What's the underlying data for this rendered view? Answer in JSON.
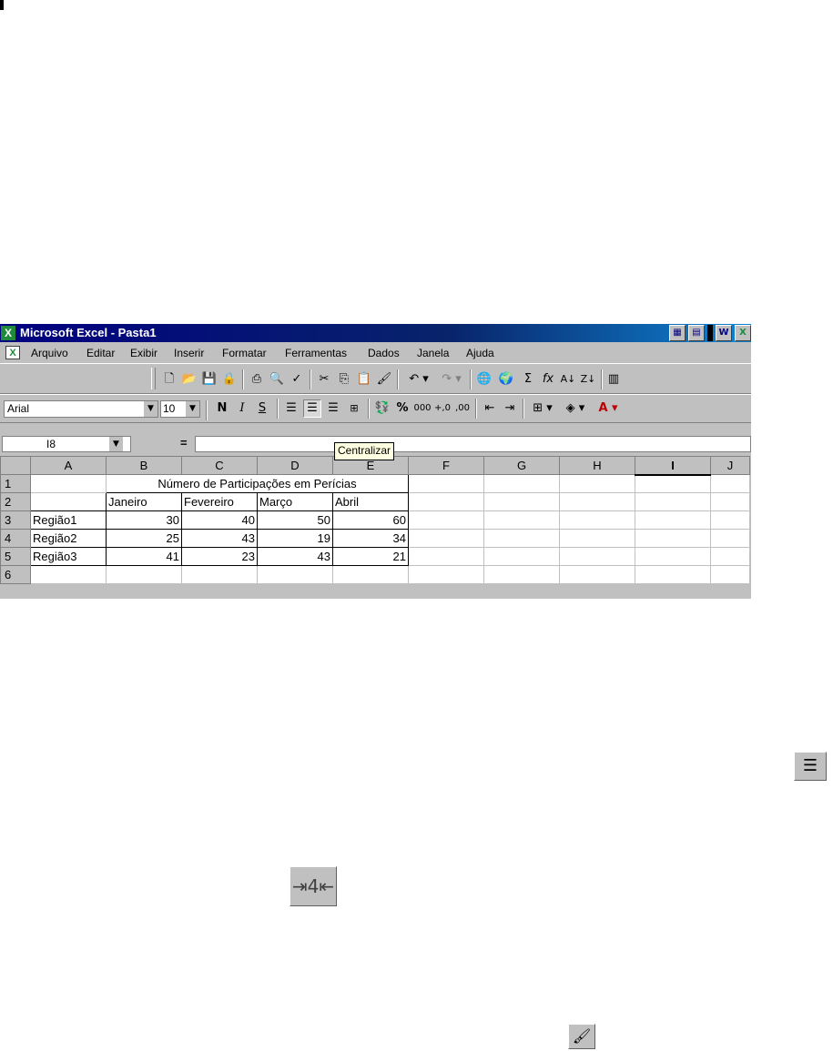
{
  "window": {
    "title": "Microsoft Excel - Pasta1"
  },
  "menu": [
    "Arquivo",
    "Editar",
    "Exibir",
    "Inserir",
    "Formatar",
    "Ferramentas",
    "Dados",
    "Janela",
    "Ajuda"
  ],
  "formatting": {
    "font": "Arial",
    "size": "10",
    "bold": "N",
    "italic": "I",
    "underline": "S"
  },
  "formula_bar": {
    "cell_ref": "I8",
    "equals": "=",
    "content": ""
  },
  "tooltip": "Centralizar",
  "grid": {
    "columns": [
      "A",
      "B",
      "C",
      "D",
      "E",
      "F",
      "G",
      "H",
      "I",
      "J"
    ],
    "rows": [
      {
        "n": "1",
        "merged_title": "Número de Participações em Perícias"
      },
      {
        "n": "2",
        "cells": [
          "",
          "Janeiro",
          "Fevereiro",
          "Março",
          "Abril"
        ]
      },
      {
        "n": "3",
        "cells": [
          "Região1",
          "30",
          "40",
          "50",
          "60"
        ]
      },
      {
        "n": "4",
        "cells": [
          "Região2",
          "25",
          "43",
          "19",
          "34"
        ]
      },
      {
        "n": "5",
        "cells": [
          "Região3",
          "41",
          "23",
          "43",
          "21"
        ]
      },
      {
        "n": "6",
        "cells": [
          "",
          "",
          "",
          "",
          ""
        ]
      }
    ]
  },
  "icons": {
    "center_align": "center-align-icon",
    "merge_center": "merge-and-center-icon",
    "format_painter": "format-painter-icon"
  }
}
